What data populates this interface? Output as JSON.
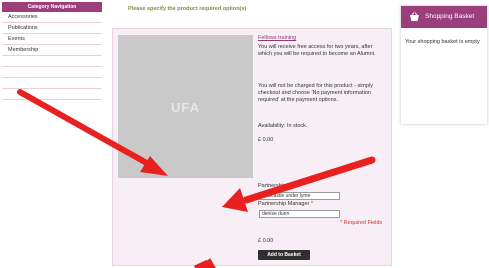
{
  "category_nav": {
    "header": "Category Navigation",
    "items": [
      "Accessories",
      "Publications",
      "Events",
      "Membership"
    ]
  },
  "main": {
    "heading": "Please specify the product required option(s)",
    "image_label": "UFA",
    "product_title": "Fellows training",
    "desc_1": "You will receive free access for two years, after which you will be required to become an Alumni.",
    "desc_2": "You will not be charged for this product - simply checkout and choose 'No payment information required' at the payment options.",
    "availability": "Availability: In stock.",
    "price": "£ 0.00",
    "partnership_area_label": "Partnership Area",
    "partnership_area_value": "newcastle under lyme",
    "partnership_manager_label": "Partnership Manager",
    "partnership_manager_value": "denise dunn",
    "required_star": "*",
    "required_note": "* Required Fields",
    "total_price": "£ 0.00",
    "add_button": "Add to Basket"
  },
  "basket": {
    "title": "Shopping Basket",
    "message": "Your shopping basket is empty"
  },
  "colors": {
    "brand": "#9b3f7c",
    "heading_green": "#7f8f3e",
    "arrow_red": "#e82020"
  }
}
